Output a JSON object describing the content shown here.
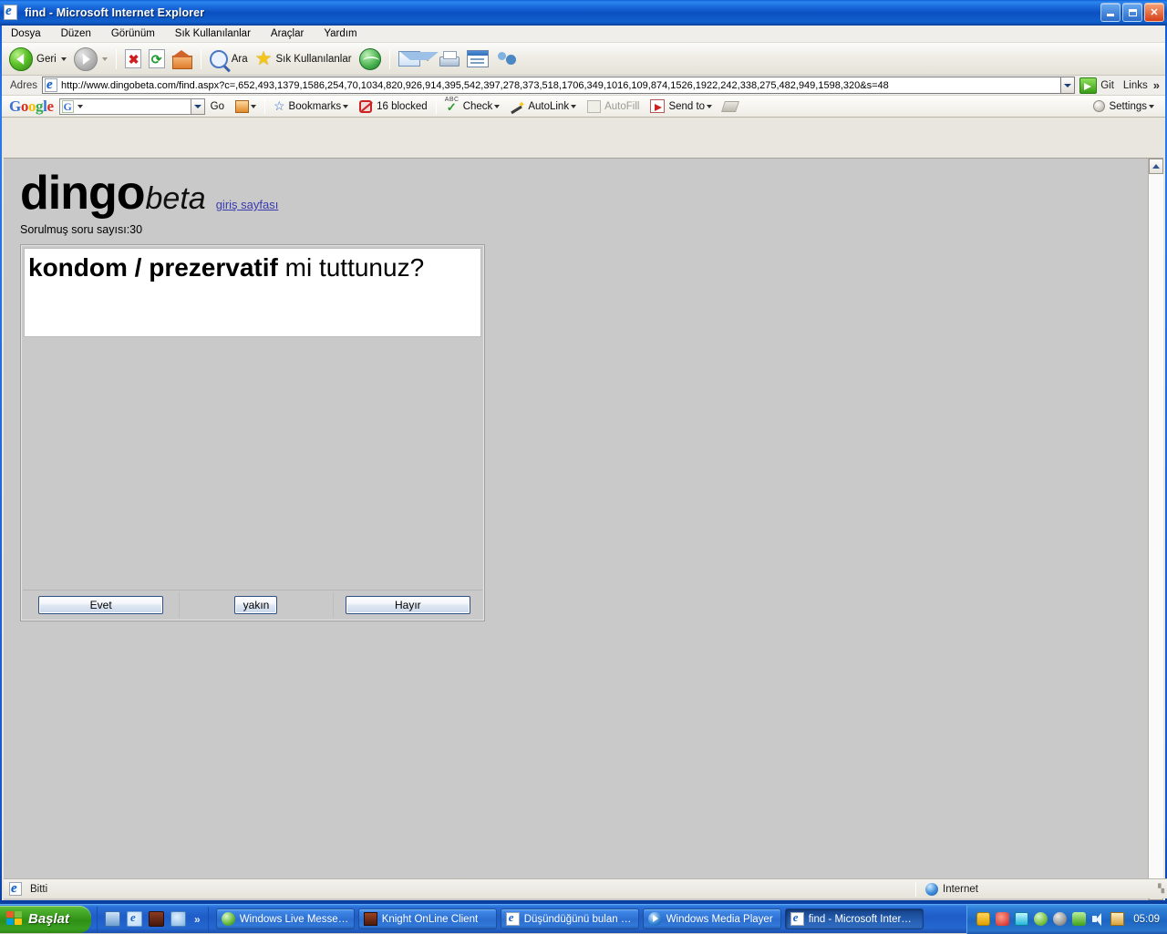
{
  "window": {
    "title": "find - Microsoft Internet Explorer",
    "title_icon": "ie-document-icon",
    "minimize_label": "Minimize",
    "maximize_label": "Maximize",
    "close_label": "Close"
  },
  "menubar": {
    "items": [
      {
        "label": "Dosya"
      },
      {
        "label": "Düzen"
      },
      {
        "label": "Görünüm"
      },
      {
        "label": "Sık Kullanılanlar"
      },
      {
        "label": "Araçlar"
      },
      {
        "label": "Yardım"
      }
    ]
  },
  "toolbar": {
    "back_label": "Geri",
    "forward_label": "",
    "stop_label": "",
    "refresh_label": "",
    "home_label": "",
    "search_label": "Ara",
    "favorites_label": "Sık Kullanılanlar",
    "history_label": "",
    "mail_label": "",
    "print_label": "",
    "edit_label": "",
    "messenger_label": ""
  },
  "address": {
    "label": "Adres",
    "url": "http://www.dingobeta.com/find.aspx?c=,652,493,1379,1586,254,70,1034,820,926,914,395,542,397,278,373,518,1706,349,1016,109,874,1526,1922,242,338,275,482,949,1598,320&s=48",
    "go_label": "Git",
    "links_label": "Links"
  },
  "google_toolbar": {
    "logo": "Google",
    "search_value": "",
    "badge": "G",
    "go_label": "Go",
    "bookmarks_label": "Bookmarks",
    "blocked_label": "16 blocked",
    "check_label": "Check",
    "check_sup": "ABC",
    "autolink_label": "AutoLink",
    "autofill_label": "AutoFill",
    "sendto_label": "Send to",
    "settings_label": "Settings"
  },
  "page": {
    "brand_main": "dingo",
    "brand_beta": "beta",
    "brand_link": "giriş sayfası",
    "question_count": "Sorulmuş soru sayısı:30",
    "question_bold": "kondom / prezervatif",
    "question_rest": " mi tuttunuz?",
    "buttons": {
      "yes": "Evet",
      "close": "yakın",
      "no": "Hayır"
    }
  },
  "statusbar": {
    "text": "Bitti",
    "zone": "Internet"
  },
  "taskbar": {
    "start_label": "Başlat",
    "quick_launch": [
      {
        "name": "show-desktop"
      },
      {
        "name": "internet-explorer"
      },
      {
        "name": "knight-online"
      },
      {
        "name": "media-shortcut"
      }
    ],
    "quick_more": "»",
    "tasks": [
      {
        "label": "Windows Live Messe…",
        "icon": "msn",
        "active": false
      },
      {
        "label": "Knight OnLine Client",
        "icon": "ko",
        "active": false
      },
      {
        "label": "Düşündüğünü bulan …",
        "icon": "ie",
        "active": false
      },
      {
        "label": "Windows Media Player",
        "icon": "wmp",
        "active": false
      },
      {
        "label": "find - Microsoft Inter…",
        "icon": "ie",
        "active": true
      }
    ],
    "clock": "05:09"
  }
}
